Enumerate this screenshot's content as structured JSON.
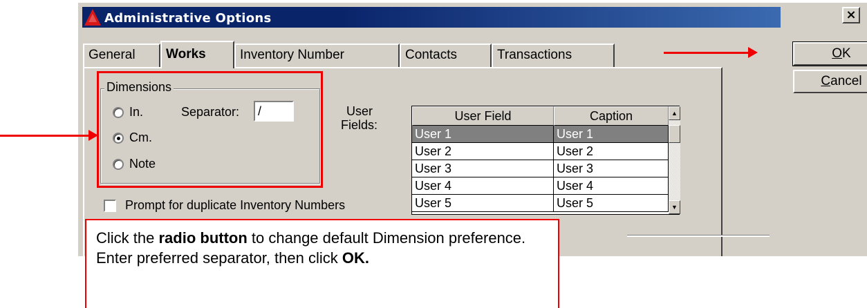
{
  "window": {
    "title": "Administrative Options",
    "close_label": "×"
  },
  "tabs": [
    {
      "label": "General",
      "active": false
    },
    {
      "label": "Works",
      "active": true
    },
    {
      "label": "Inventory Number",
      "active": false
    },
    {
      "label": "Contacts",
      "active": false
    },
    {
      "label": "Transactions",
      "active": false
    }
  ],
  "dimensions": {
    "group_label": "Dimensions",
    "options": [
      {
        "label": "In.",
        "selected": false
      },
      {
        "label": "Cm.",
        "selected": true
      },
      {
        "label": "Note",
        "selected": false
      }
    ],
    "separator_label": "Separator:",
    "separator_value": "/"
  },
  "prompt_duplicates": {
    "label": "Prompt for duplicate Inventory Numbers",
    "checked": false
  },
  "user_fields": {
    "label_line1": "User",
    "label_line2": "Fields:",
    "columns": [
      "User Field",
      "Caption"
    ],
    "rows": [
      [
        "User 1",
        "User 1"
      ],
      [
        "User 2",
        "User 2"
      ],
      [
        "User 3",
        "User 3"
      ],
      [
        "User 4",
        "User 4"
      ],
      [
        "User 5",
        "User 5"
      ]
    ],
    "selected_row": 0
  },
  "buttons": {
    "ok_label": "OK",
    "ok_underline": "O",
    "ok_rest": "K",
    "cancel_label": "Cancel",
    "cancel_underline": "C",
    "cancel_rest": "ancel"
  },
  "callout": {
    "part1": "Click the ",
    "bold1": "radio button",
    "part2": " to change default Dimension preference. Enter preferred separator, then click ",
    "bold2": "OK."
  },
  "colors": {
    "annotation_red": "#ee0000",
    "window_face": "#d4d0c8",
    "title_bar": "#0a246a",
    "selected_row": "#808080"
  }
}
